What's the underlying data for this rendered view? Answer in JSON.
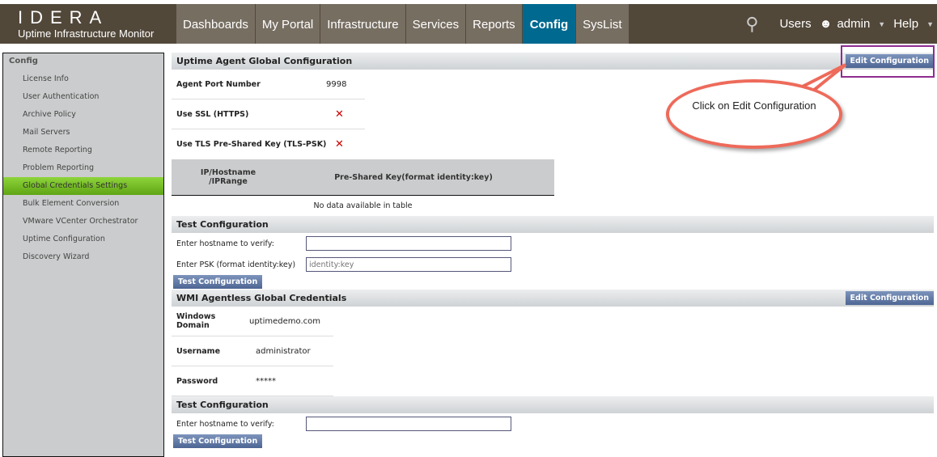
{
  "header": {
    "brand": "IDERA",
    "product": "Uptime Infrastructure Monitor",
    "tabs": [
      "Dashboards",
      "My Portal",
      "Infrastructure",
      "Services",
      "Reports",
      "Config",
      "SysList"
    ],
    "active_tab": "Config",
    "users": "Users",
    "user": "admin",
    "help": "Help"
  },
  "sidebar": {
    "title": "Config",
    "items": [
      "License Info",
      "User Authentication",
      "Archive Policy",
      "Mail Servers",
      "Remote Reporting",
      "Problem Reporting",
      "Global Credentials Settings",
      "Bulk Element Conversion",
      "VMware VCenter Orchestrator",
      "Uptime Configuration",
      "Discovery Wizard"
    ],
    "active": "Global Credentials Settings"
  },
  "agent": {
    "title": "Uptime Agent Global Configuration",
    "edit": "Edit Configuration",
    "port_label": "Agent Port Number",
    "port": "9998",
    "ssl_label": "Use SSL (HTTPS)",
    "tls_label": "Use TLS Pre-Shared Key (TLS-PSK)",
    "col1": "IP/Hostname /IPRange",
    "col2": "Pre-Shared Key(format identity:key)",
    "empty": "No data available in table"
  },
  "test1": {
    "title": "Test Configuration",
    "host_label": "Enter hostname to verify:",
    "psk_label": "Enter PSK (format identity:key)",
    "psk_placeholder": "identity:key",
    "button": "Test Configuration"
  },
  "wmi": {
    "title": "WMI Agentless Global Credentials",
    "edit": "Edit Configuration",
    "domain_label": "Windows Domain",
    "domain": "uptimedemo.com",
    "user_label": "Username",
    "user": "administrator",
    "pass_label": "Password",
    "pass": "*****"
  },
  "test2": {
    "title": "Test Configuration",
    "host_label": "Enter hostname to verify:",
    "button": "Test Configuration"
  },
  "callout": {
    "text": "Click on Edit Configuration"
  }
}
